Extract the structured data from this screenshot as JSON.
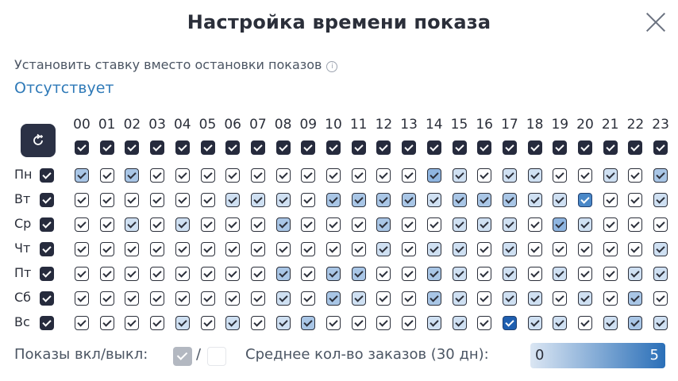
{
  "dialog": {
    "title": "Настройка времени показа",
    "rate_label": "Установить ставку вместо остановки показов",
    "rate_value": "Отсутствует",
    "info_glyph": "i"
  },
  "hours": [
    "00",
    "01",
    "02",
    "03",
    "04",
    "05",
    "06",
    "07",
    "08",
    "09",
    "10",
    "11",
    "12",
    "13",
    "14",
    "15",
    "16",
    "17",
    "18",
    "19",
    "20",
    "21",
    "22",
    "23"
  ],
  "days": [
    "Пн",
    "Вт",
    "Ср",
    "Чт",
    "Пт",
    "Сб",
    "Вс"
  ],
  "grid_intensity": [
    [
      2,
      0,
      2,
      0,
      0,
      0,
      0,
      0,
      0,
      0,
      0,
      0,
      0,
      0,
      3,
      1,
      0,
      1,
      1,
      0,
      0,
      1,
      0,
      2
    ],
    [
      0,
      0,
      0,
      0,
      0,
      0,
      1,
      1,
      1,
      0,
      2,
      2,
      2,
      2,
      1,
      2,
      2,
      2,
      1,
      1,
      4,
      0,
      0,
      1
    ],
    [
      0,
      0,
      1,
      0,
      1,
      0,
      0,
      0,
      2,
      0,
      0,
      0,
      2,
      0,
      0,
      1,
      1,
      1,
      0,
      3,
      1,
      0,
      0,
      0
    ],
    [
      0,
      0,
      0,
      0,
      0,
      0,
      0,
      0,
      0,
      0,
      0,
      0,
      1,
      0,
      1,
      1,
      0,
      1,
      0,
      0,
      0,
      0,
      0,
      1
    ],
    [
      0,
      0,
      0,
      0,
      0,
      0,
      0,
      0,
      2,
      0,
      2,
      2,
      0,
      0,
      2,
      1,
      0,
      1,
      0,
      1,
      0,
      0,
      1,
      1
    ],
    [
      0,
      0,
      0,
      0,
      0,
      0,
      0,
      0,
      1,
      0,
      2,
      1,
      0,
      0,
      2,
      1,
      0,
      1,
      1,
      0,
      1,
      0,
      2,
      0
    ],
    [
      0,
      0,
      0,
      0,
      1,
      0,
      1,
      0,
      1,
      2,
      0,
      0,
      0,
      0,
      1,
      1,
      0,
      6,
      1,
      1,
      0,
      1,
      2,
      1
    ]
  ],
  "legend": {
    "toggle_label": "Показы вкл/выкл:",
    "slash": "/",
    "avg_label": "Среднее кол-во заказов (30 дн):",
    "min": "0",
    "max": "5"
  },
  "colors": {
    "level0": "#ffffff",
    "level1": "#cfe0f2",
    "level2": "#a9c6e6",
    "level3": "#8fb5e0",
    "level4": "#4a88c8",
    "level6": "#1f5fb0",
    "dark": "#262b3d",
    "accent_link": "#2f7ab8"
  }
}
